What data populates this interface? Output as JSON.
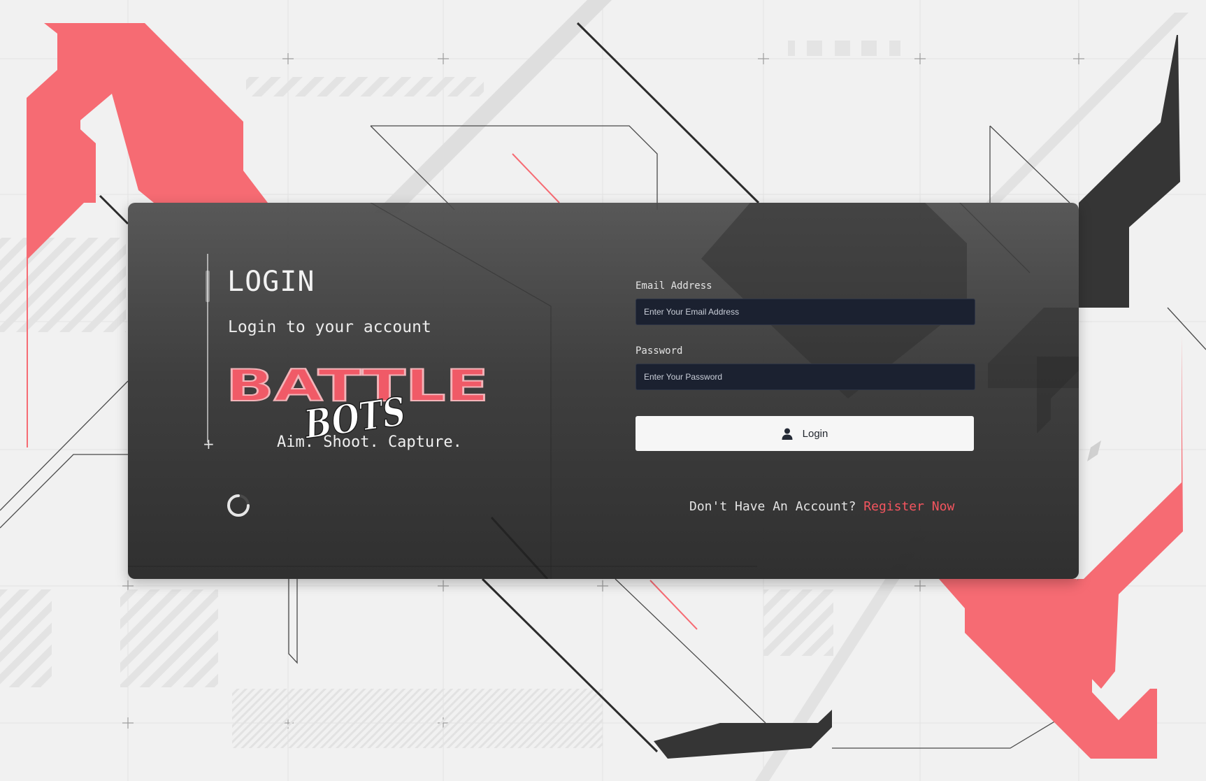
{
  "theme": {
    "accent": "#f66b73",
    "link": "#f5555f",
    "card": "#454545",
    "input_bg": "#1b2130",
    "dark_shape": "#333333"
  },
  "login": {
    "title": "LOGIN",
    "subtitle": "Login to your account",
    "logo_text_main": "BATTLE",
    "logo_text_script": "BOTS",
    "tagline": "Aim. Shoot. Capture."
  },
  "form": {
    "email_label": "Email Address",
    "email_placeholder": "Enter Your Email Address",
    "email_value": "",
    "password_label": "Password",
    "password_placeholder": "Enter Your Password",
    "password_value": "",
    "login_button_label": "Login",
    "login_button_icon": "user-icon"
  },
  "register": {
    "prompt": "Don't Have An Account?",
    "link_label": "Register Now"
  },
  "loading_indicator": "spinner-icon"
}
